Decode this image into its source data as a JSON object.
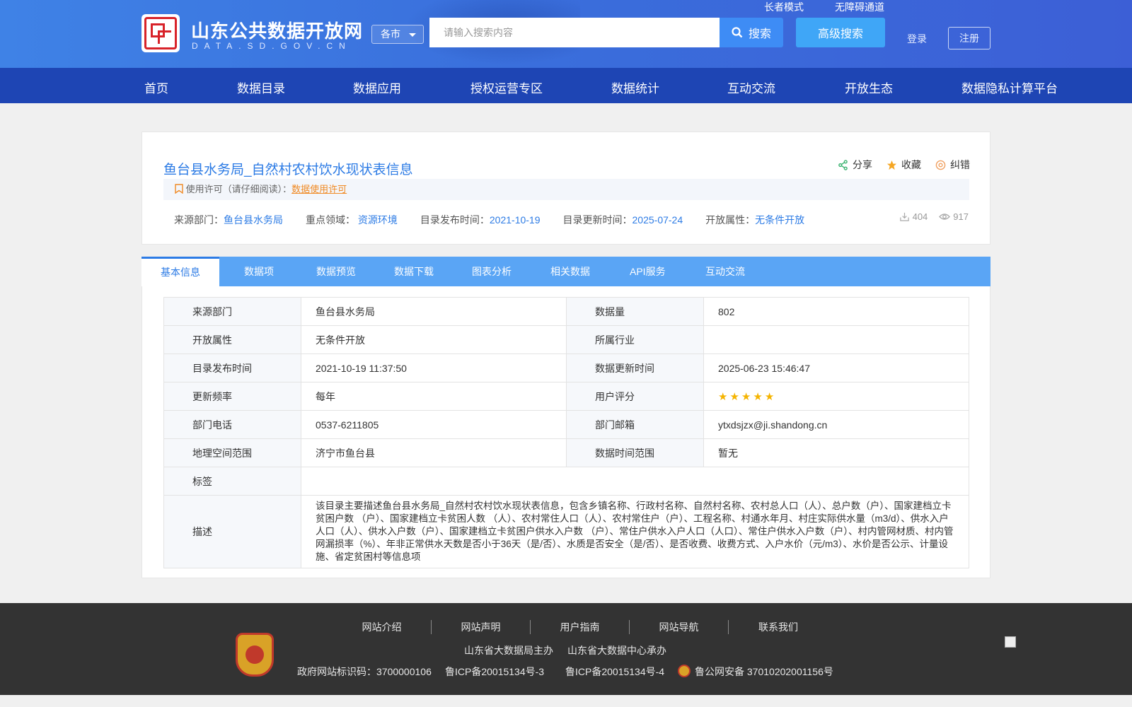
{
  "header": {
    "site_name": "山东公共数据开放网",
    "site_domain": "DATA.SD.GOV.CN",
    "elder_mode": "长者模式",
    "accessibility": "无障碍通道",
    "city_select": "各市",
    "search_placeholder": "请输入搜索内容",
    "search_label": "搜索",
    "advanced_search": "高级搜索",
    "login": "登录",
    "register": "注册"
  },
  "nav": [
    "首页",
    "数据目录",
    "数据应用",
    "授权运营专区",
    "数据统计",
    "互动交流",
    "开放生态",
    "数据隐私计算平台"
  ],
  "dataset": {
    "title": "鱼台县水务局_自然村农村饮水现状表信息",
    "actions": {
      "share": "分享",
      "favorite": "收藏",
      "report": "纠错"
    },
    "license_label": "使用许可（请仔细阅读）：",
    "license_link": "数据使用许可",
    "meta": {
      "source_label": "来源部门：",
      "source": "鱼台县水务局",
      "field_label": "重点领域：",
      "field": "资源环境",
      "publish_label": "目录发布时间：",
      "publish": "2021-10-19",
      "update_label": "目录更新时间：",
      "update": "2025-07-24",
      "open_label": "开放属性：",
      "open": "无条件开放"
    },
    "downloads": "404",
    "views": "917"
  },
  "tabs": [
    "基本信息",
    "数据项",
    "数据预览",
    "数据下载",
    "图表分析",
    "相关数据",
    "API服务",
    "互动交流"
  ],
  "info": {
    "r1": {
      "k1": "来源部门",
      "v1": "鱼台县水务局",
      "k2": "数据量",
      "v2": "802"
    },
    "r2": {
      "k1": "开放属性",
      "v1": "无条件开放",
      "k2": "所属行业",
      "v2": ""
    },
    "r3": {
      "k1": "目录发布时间",
      "v1": "2021-10-19 11:37:50",
      "k2": "数据更新时间",
      "v2": "2025-06-23 15:46:47"
    },
    "r4": {
      "k1": "更新频率",
      "v1": "每年",
      "k2": "用户评分",
      "rating": 5
    },
    "r5": {
      "k1": "部门电话",
      "v1": "0537-6211805",
      "k2": "部门邮箱",
      "v2": "ytxdsjzx@ji.shandong.cn"
    },
    "r6": {
      "k1": "地理空间范围",
      "v1": "济宁市鱼台县",
      "k2": "数据时间范围",
      "v2": "暂无"
    },
    "r7": {
      "k1": "标签",
      "v1": ""
    },
    "r8": {
      "k1": "描述",
      "v1": "该目录主要描述鱼台县水务局_自然村农村饮水现状表信息，包含乡镇名称、行政村名称、自然村名称、农村总人口（人）、总户数（户）、国家建档立卡贫困户数 （户）、国家建档立卡贫困人数 （人）、农村常住人口（人）、农村常住户（户）、工程名称、村通水年月、村庄实际供水量（m3/d）、供水入户人口（人）、供水入户数（户）、国家建档立卡贫困户供水入户数 （户）、常住户供水入户人口（人口）、常住户供水入户数（户）、村内管网材质、村内管网漏损率（%）、年非正常供水天数是否小于36天（是/否）、水质是否安全（是/否）、是否收费、收费方式、入户水价（元/m3）、水价是否公示、计量设施、省定贫困村等信息项"
    }
  },
  "footer": {
    "links": [
      "网站介绍",
      "网站声明",
      "用户指南",
      "网站导航",
      "联系我们"
    ],
    "host": "山东省大数据局主办",
    "organizer": "山东省大数据中心承办",
    "gov_id": "政府网站标识码：3700000106",
    "icp1": "鲁ICP备20015134号-3",
    "icp2": "鲁ICP备20015134号-4",
    "police": "鲁公网安备 37010202001156号"
  }
}
